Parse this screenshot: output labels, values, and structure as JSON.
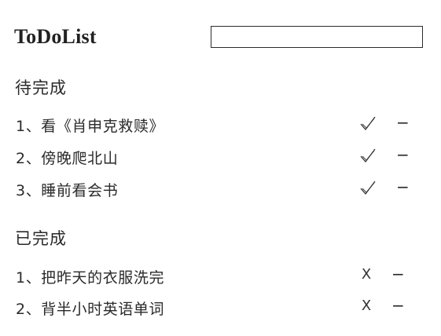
{
  "header": {
    "title": "ToDoList",
    "input_value": "",
    "input_placeholder": ""
  },
  "todo": {
    "heading": "待完成",
    "items": [
      {
        "text": "1、看《肖申克救赎》",
        "check_icon": "check-icon",
        "remove_label": "−"
      },
      {
        "text": "2、傍晚爬北山",
        "check_icon": "check-icon",
        "remove_label": "−"
      },
      {
        "text": "3、睡前看会书",
        "check_icon": "check-icon",
        "remove_label": "−"
      }
    ]
  },
  "done": {
    "heading": "已完成",
    "items": [
      {
        "text": "1、把昨天的衣服洗完",
        "undo_label": "X",
        "remove_label": "−"
      },
      {
        "text": "2、背半小时英语单词",
        "undo_label": "X",
        "remove_label": "−"
      }
    ]
  }
}
